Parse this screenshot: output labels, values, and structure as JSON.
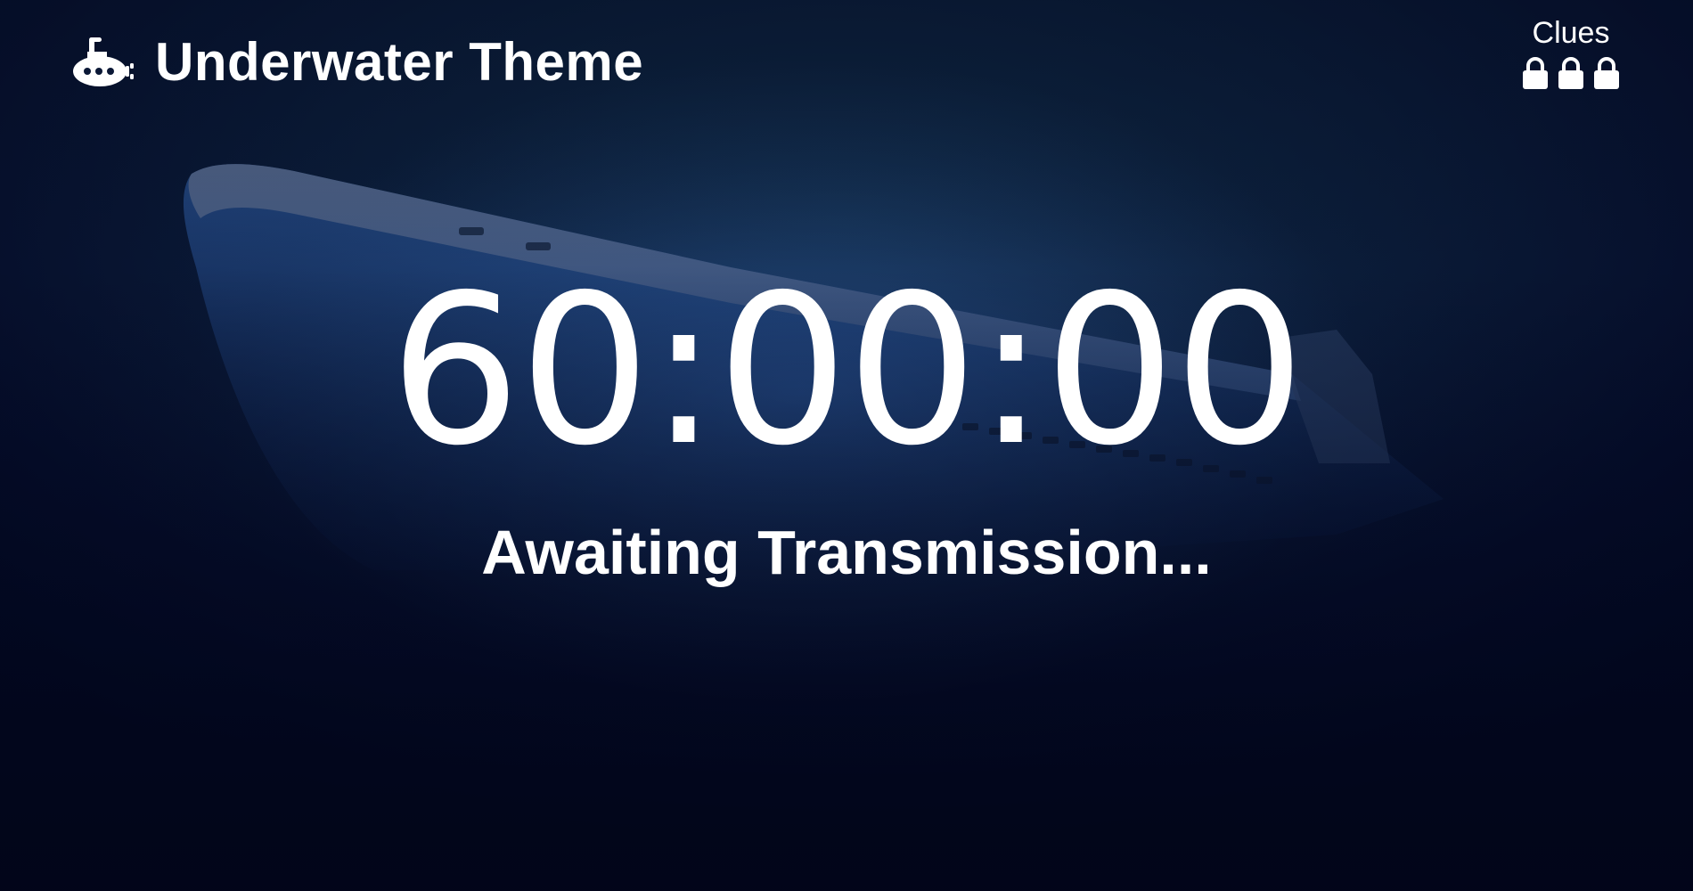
{
  "header": {
    "title": "Underwater Theme",
    "icon": "submarine-icon"
  },
  "clues": {
    "label": "Clues",
    "locked_count": 3,
    "icon": "lock-icon"
  },
  "timer": {
    "display": "60:00:00"
  },
  "status": {
    "text": "Awaiting Transmission..."
  }
}
